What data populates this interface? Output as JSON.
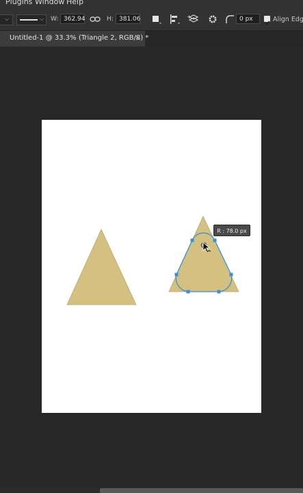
{
  "menu": {
    "items": [
      "Plugins",
      "Window",
      "Help"
    ]
  },
  "options_bar": {
    "width_label": "W:",
    "width_value": "362.94",
    "height_label": "H:",
    "height_value": "381.06",
    "radius_value": "0 px",
    "align_edges_label": "Align Edges",
    "align_edges_checked": true
  },
  "document_tab": {
    "title": "Untitled-1 @ 33.3% (Triangle 2, RGB/8) *",
    "close_glyph": "×"
  },
  "canvas": {
    "shape_fill": "#d4c181",
    "path_color": "#3b8fd6",
    "radius_tooltip": "R :  78.0 px"
  },
  "colors": {
    "panel_bg": "#323232",
    "pasteboard": "#282828",
    "artboard": "#ffffff"
  }
}
